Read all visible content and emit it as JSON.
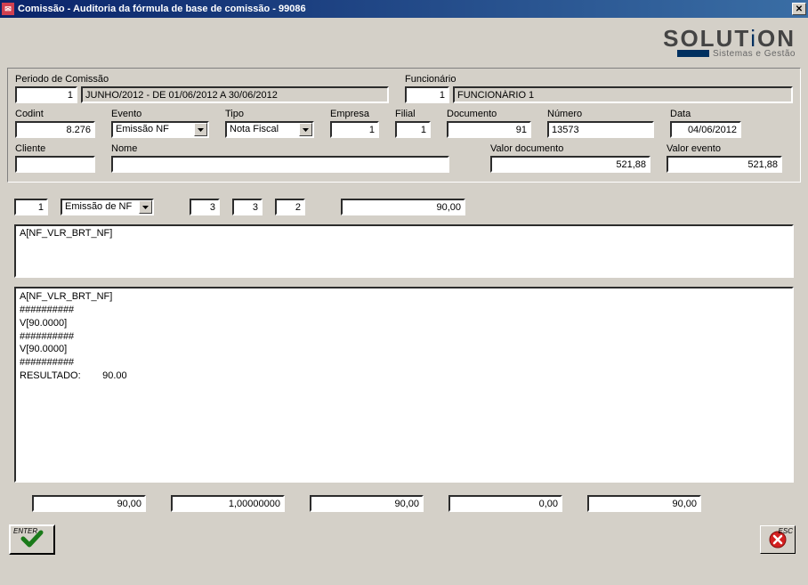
{
  "window": {
    "title": "Comissão - Auditoria da fórmula de base de comissão - 99086",
    "close_glyph": "✕"
  },
  "logo": {
    "text": "SOLUTiON",
    "subtitle": "Sistemas e Gestão"
  },
  "header": {
    "periodo_label": "Periodo de Comissão",
    "periodo_code": "1",
    "periodo_desc": "JUNHO/2012 - DE 01/06/2012 A 30/06/2012",
    "funcionario_label": "Funcionário",
    "funcionario_code": "1",
    "funcionario_desc": "FUNCIONÁRIO 1",
    "codint_label": "Codint",
    "codint": "8.276",
    "evento_label": "Evento",
    "evento": "Emissão NF",
    "tipo_label": "Tipo",
    "tipo": "Nota Fiscal",
    "empresa_label": "Empresa",
    "empresa": "1",
    "filial_label": "Filial",
    "filial": "1",
    "documento_label": "Documento",
    "documento": "91",
    "numero_label": "Número",
    "numero": "13573",
    "data_label": "Data",
    "data": "04/06/2012",
    "cliente_label": "Cliente",
    "cliente": "",
    "nome_label": "Nome",
    "nome": "",
    "valor_doc_label": "Valor documento",
    "valor_doc": "521,88",
    "valor_evt_label": "Valor evento",
    "valor_evt": "521,88"
  },
  "mid": {
    "n1": "1",
    "combo": "Emissão de NF",
    "n2": "3",
    "n3": "3",
    "n4": "2",
    "n5": "90,00"
  },
  "formula": "A[NF_VLR_BRT_NF]",
  "trace": "A[NF_VLR_BRT_NF]\n##########\nV[90.0000]\n##########\nV[90.0000]\n##########\nRESULTADO:        90.00",
  "bottom": {
    "v1": "90,00",
    "v2": "1,00000000",
    "v3": "90,00",
    "v4": "0,00",
    "v5": "90,00"
  },
  "actions": {
    "enter": "ENTER",
    "esc": "ESC"
  }
}
